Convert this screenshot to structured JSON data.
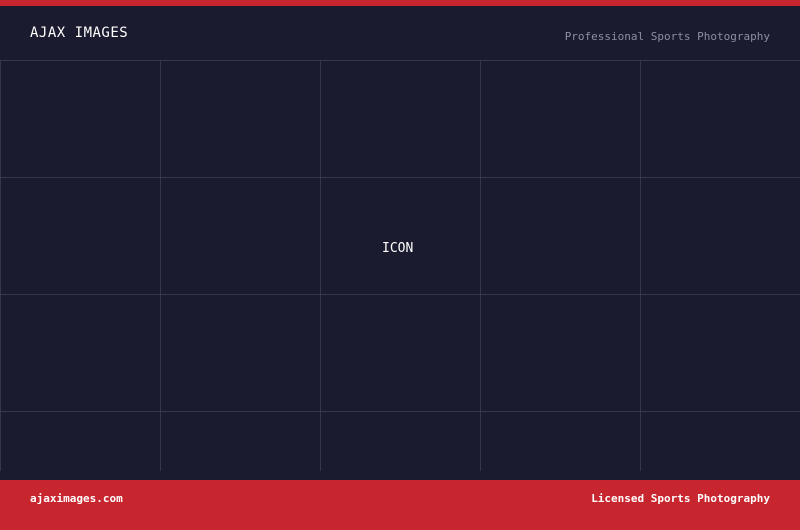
{
  "header": {
    "brand": "AJAX IMAGES",
    "tagline": "Professional Sports Photography"
  },
  "main": {
    "placeholder_label": "ICON"
  },
  "footer": {
    "domain": "ajaximages.com",
    "tagline": "Licensed Sports Photography"
  },
  "colors": {
    "background": "#1a1b2e",
    "accent": "#c8262f",
    "grid_line": "#363849",
    "muted_text": "#8c8fa3",
    "text": "#ffffff"
  }
}
